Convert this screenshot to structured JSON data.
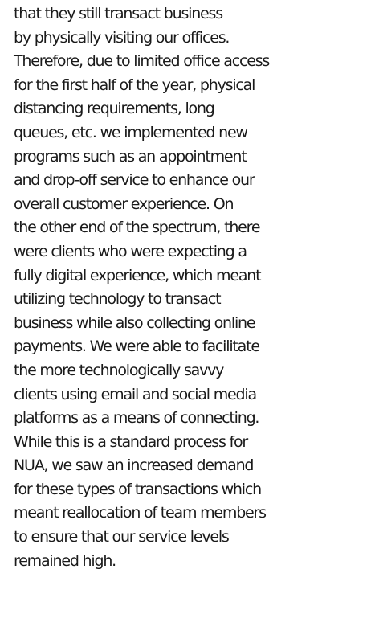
{
  "body_text": {
    "lines": [
      "that they still transact business",
      "by physically visiting our offices.",
      "Therefore, due to limited office access",
      "for the first half of the year, physical",
      "distancing requirements, long",
      "queues, etc. we implemented new",
      "programs such as an appointment",
      "and drop-off service to enhance our",
      "overall customer experience. On",
      "the other end of the spectrum, there",
      "were clients who were expecting a",
      "fully digital experience, which meant",
      "utilizing technology to transact",
      "business while also collecting online",
      "payments. We were able to facilitate",
      "the more technologically savvy",
      "clients using email and social media",
      "platforms as a means of connecting.",
      "While this is a standard process for",
      "NUA, we saw an increased demand",
      "for these types of transactions which",
      "meant reallocation of team members",
      "to ensure that our service levels",
      "remained high."
    ]
  }
}
